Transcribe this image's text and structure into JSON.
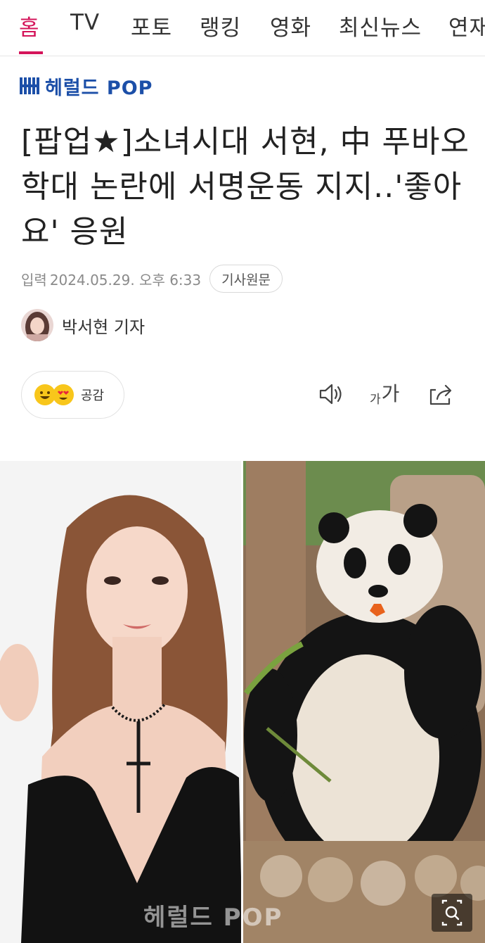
{
  "nav": {
    "tabs": [
      "홈",
      "TV",
      "포토",
      "랭킹",
      "영화",
      "최신뉴스",
      "연재"
    ],
    "active_index": 0
  },
  "brand": {
    "name": "헤럴드 POP",
    "color": "#1c4fa8"
  },
  "article": {
    "headline": "[팝업★]소녀시대 서현, 中 푸바오 학대 논란에 서명운동 지지..'좋아요' 응원",
    "date_label": "입력",
    "date": "2024.05.29. 오후 6:33",
    "source_button": "기사원문",
    "reporter": "박서현 기자"
  },
  "actions": {
    "reaction_label": "공감",
    "icons": [
      "smile-emoji-icon",
      "heart-eyes-emoji-icon",
      "speaker-icon",
      "font-size-icon",
      "share-icon"
    ],
    "font_small": "가",
    "font_big": "가"
  },
  "photo": {
    "watermark": "헤럴드 POP",
    "accent_color": "#d4145a"
  }
}
